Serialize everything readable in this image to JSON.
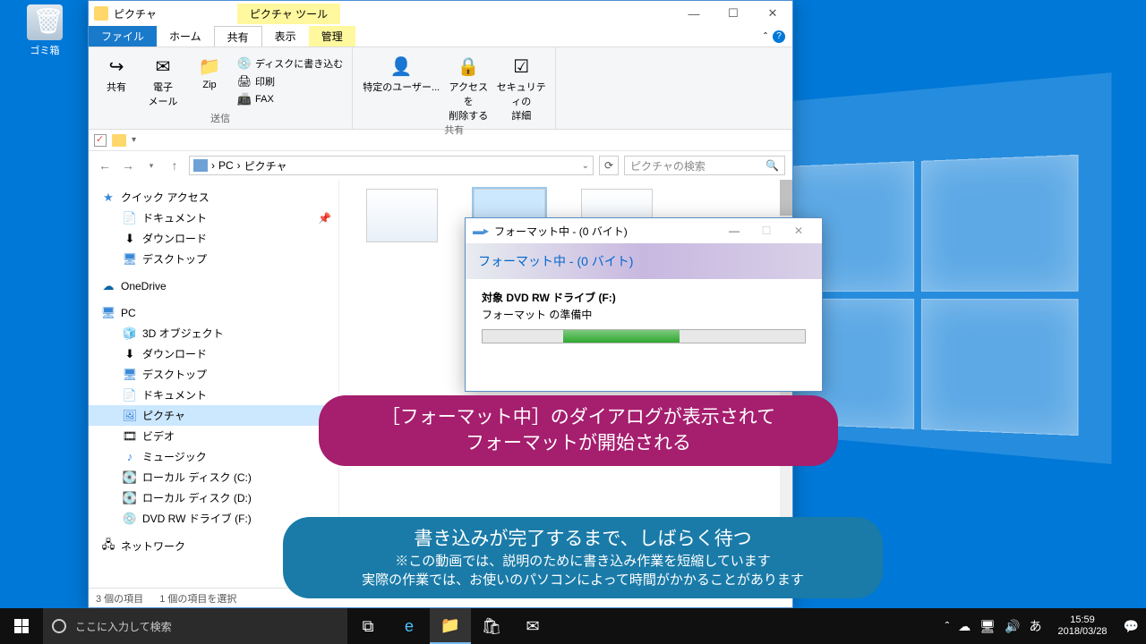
{
  "desktop": {
    "recycle_bin": "ゴミ箱"
  },
  "explorer": {
    "title": "ピクチャ",
    "tool_tab": "ピクチャ ツール",
    "tabs": {
      "file": "ファイル",
      "home": "ホーム",
      "share": "共有",
      "view": "表示",
      "manage": "管理"
    },
    "ribbon": {
      "send_group": "送信",
      "share_btn": "共有",
      "email": "電子\nメール",
      "zip": "Zip",
      "burn": "ディスクに書き込む",
      "print": "印刷",
      "fax": "FAX",
      "share_group": "共有",
      "specific_user": "特定のユーザー...",
      "remove_access": "アクセスを\n削除する",
      "security": "セキュリティの\n詳細"
    },
    "breadcrumb": {
      "pc": "PC",
      "pictures": "ピクチャ"
    },
    "search_placeholder": "ピクチャの検索",
    "nav": {
      "quick_access": "クイック アクセス",
      "documents": "ドキュメント",
      "downloads": "ダウンロード",
      "desktop": "デスクトップ",
      "onedrive": "OneDrive",
      "pc": "PC",
      "objects3d": "3D オブジェクト",
      "downloads2": "ダウンロード",
      "desktop2": "デスクトップ",
      "documents2": "ドキュメント",
      "pictures": "ピクチャ",
      "videos": "ビデオ",
      "music": "ミュージック",
      "disk_c": "ローカル ディスク (C:)",
      "disk_d": "ローカル ディスク (D:)",
      "dvd": "DVD RW ドライブ (F:)",
      "network": "ネットワーク"
    },
    "status": {
      "items": "3 個の項目",
      "selected": "1 個の項目を選択"
    }
  },
  "format_dialog": {
    "title": "フォーマット中 - (0 バイト)",
    "header": "フォーマット中 - (0 バイト)",
    "target_label": "対象",
    "target": "DVD RW ドライブ (F:)",
    "status": "フォーマット の準備中"
  },
  "annotations": {
    "a1": "［フォーマット中］のダイアログが表示されて\nフォーマットが開始される",
    "a2_main": "書き込みが完了するまで、しばらく待つ",
    "a2_sub1": "※この動画では、説明のために書き込み作業を短縮しています",
    "a2_sub2": "実際の作業では、お使いのパソコンによって時間がかかることがあります"
  },
  "taskbar": {
    "search_placeholder": "ここに入力して検索",
    "time": "15:59",
    "date": "2018/03/28"
  }
}
